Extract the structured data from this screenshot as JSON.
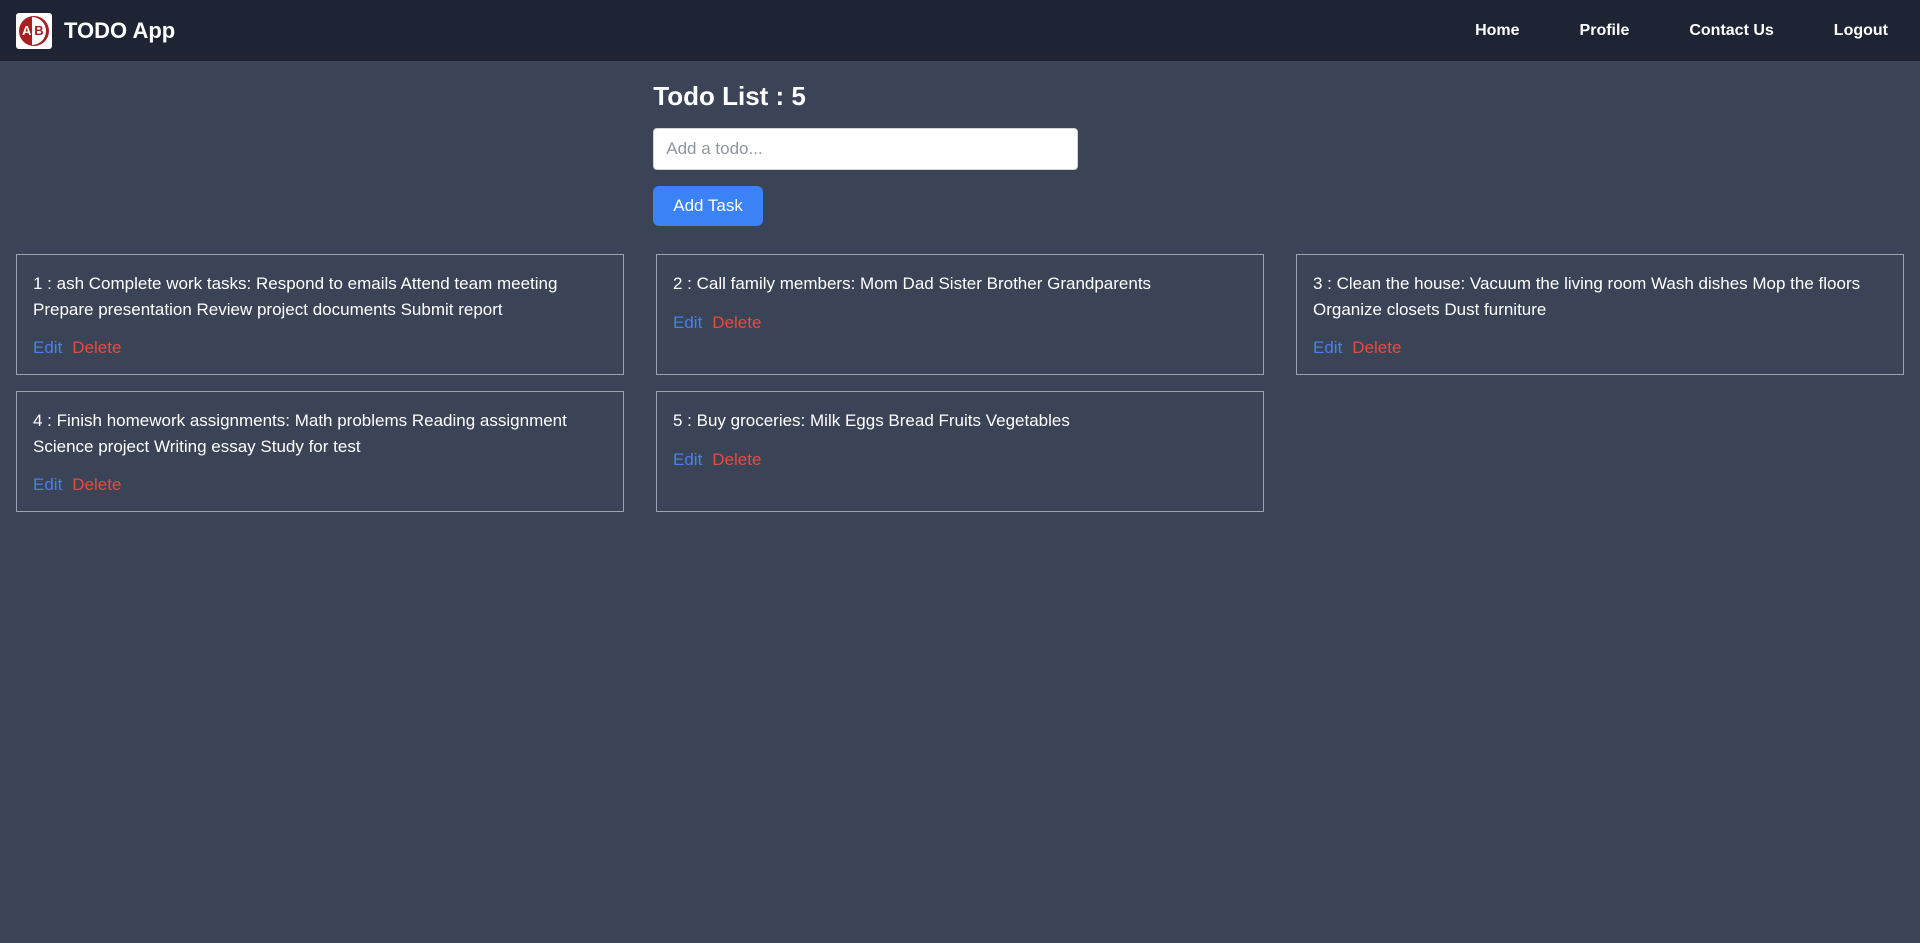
{
  "navbar": {
    "app_title": "TODO App",
    "links": {
      "home": "Home",
      "profile": "Profile",
      "contact": "Contact Us",
      "logout": "Logout"
    }
  },
  "todo": {
    "title": "Todo List : 5",
    "input_placeholder": "Add a todo...",
    "add_button": "Add Task",
    "edit_label": "Edit",
    "delete_label": "Delete",
    "items": [
      {
        "text": "1 : ash Complete work tasks: Respond to emails Attend team meeting Prepare presentation Review project documents Submit report"
      },
      {
        "text": "2 : Call family members: Mom Dad Sister Brother Grandparents"
      },
      {
        "text": "3 : Clean the house: Vacuum the living room Wash dishes Mop the floors Organize closets Dust furniture"
      },
      {
        "text": "4 : Finish homework assignments: Math problems Reading assignment Science project Writing essay Study for test"
      },
      {
        "text": "5 : Buy groceries: Milk Eggs Bread Fruits Vegetables"
      }
    ]
  }
}
